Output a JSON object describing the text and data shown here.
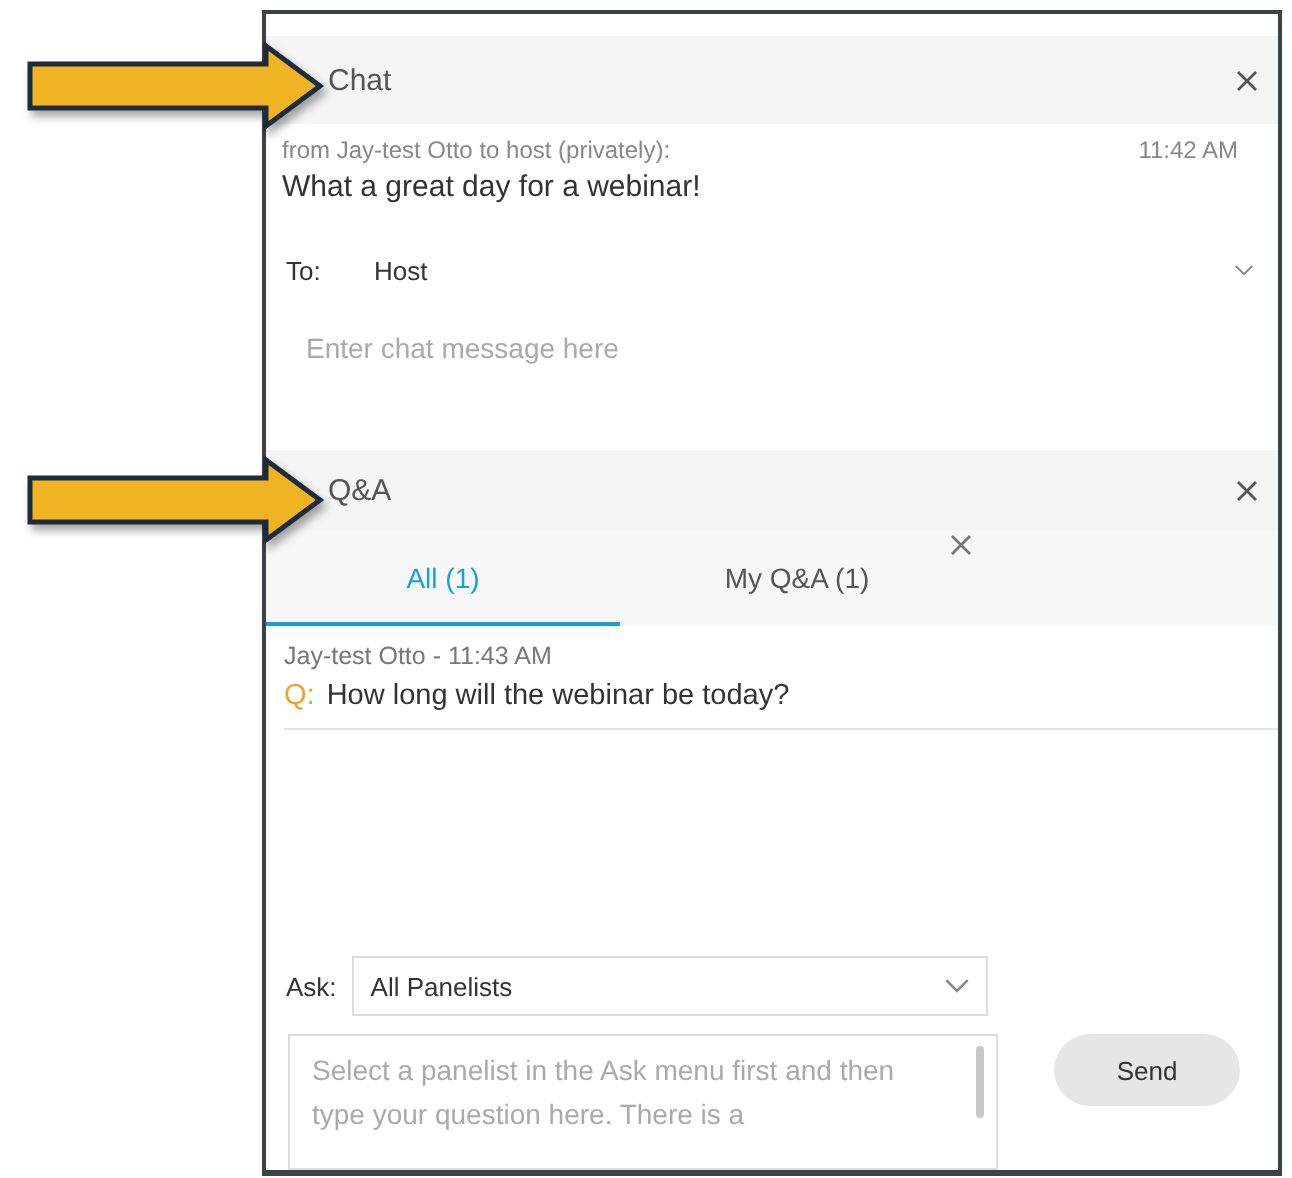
{
  "chat": {
    "title": "Chat",
    "messages": [
      {
        "header": "from Jay-test Otto to host (privately):",
        "time": "11:42 AM",
        "text": "What a great day for a webinar!"
      }
    ],
    "to_label": "To:",
    "to_value": "Host",
    "input": {
      "placeholder": "Enter chat message here"
    }
  },
  "qa": {
    "title": "Q&A",
    "tabs": [
      {
        "label": "All (1)",
        "selected": true
      },
      {
        "label": "My Q&A (1)",
        "selected": false
      }
    ],
    "questions": [
      {
        "meta": "Jay-test Otto - 11:43 AM",
        "prefix": "Q:",
        "text": "How long will the webinar be today?"
      }
    ],
    "ask_label": "Ask:",
    "ask_value": "All Panelists",
    "question_input": {
      "placeholder": "Select a panelist in the Ask menu first and then type your question here. There is a"
    },
    "send": "Send"
  }
}
